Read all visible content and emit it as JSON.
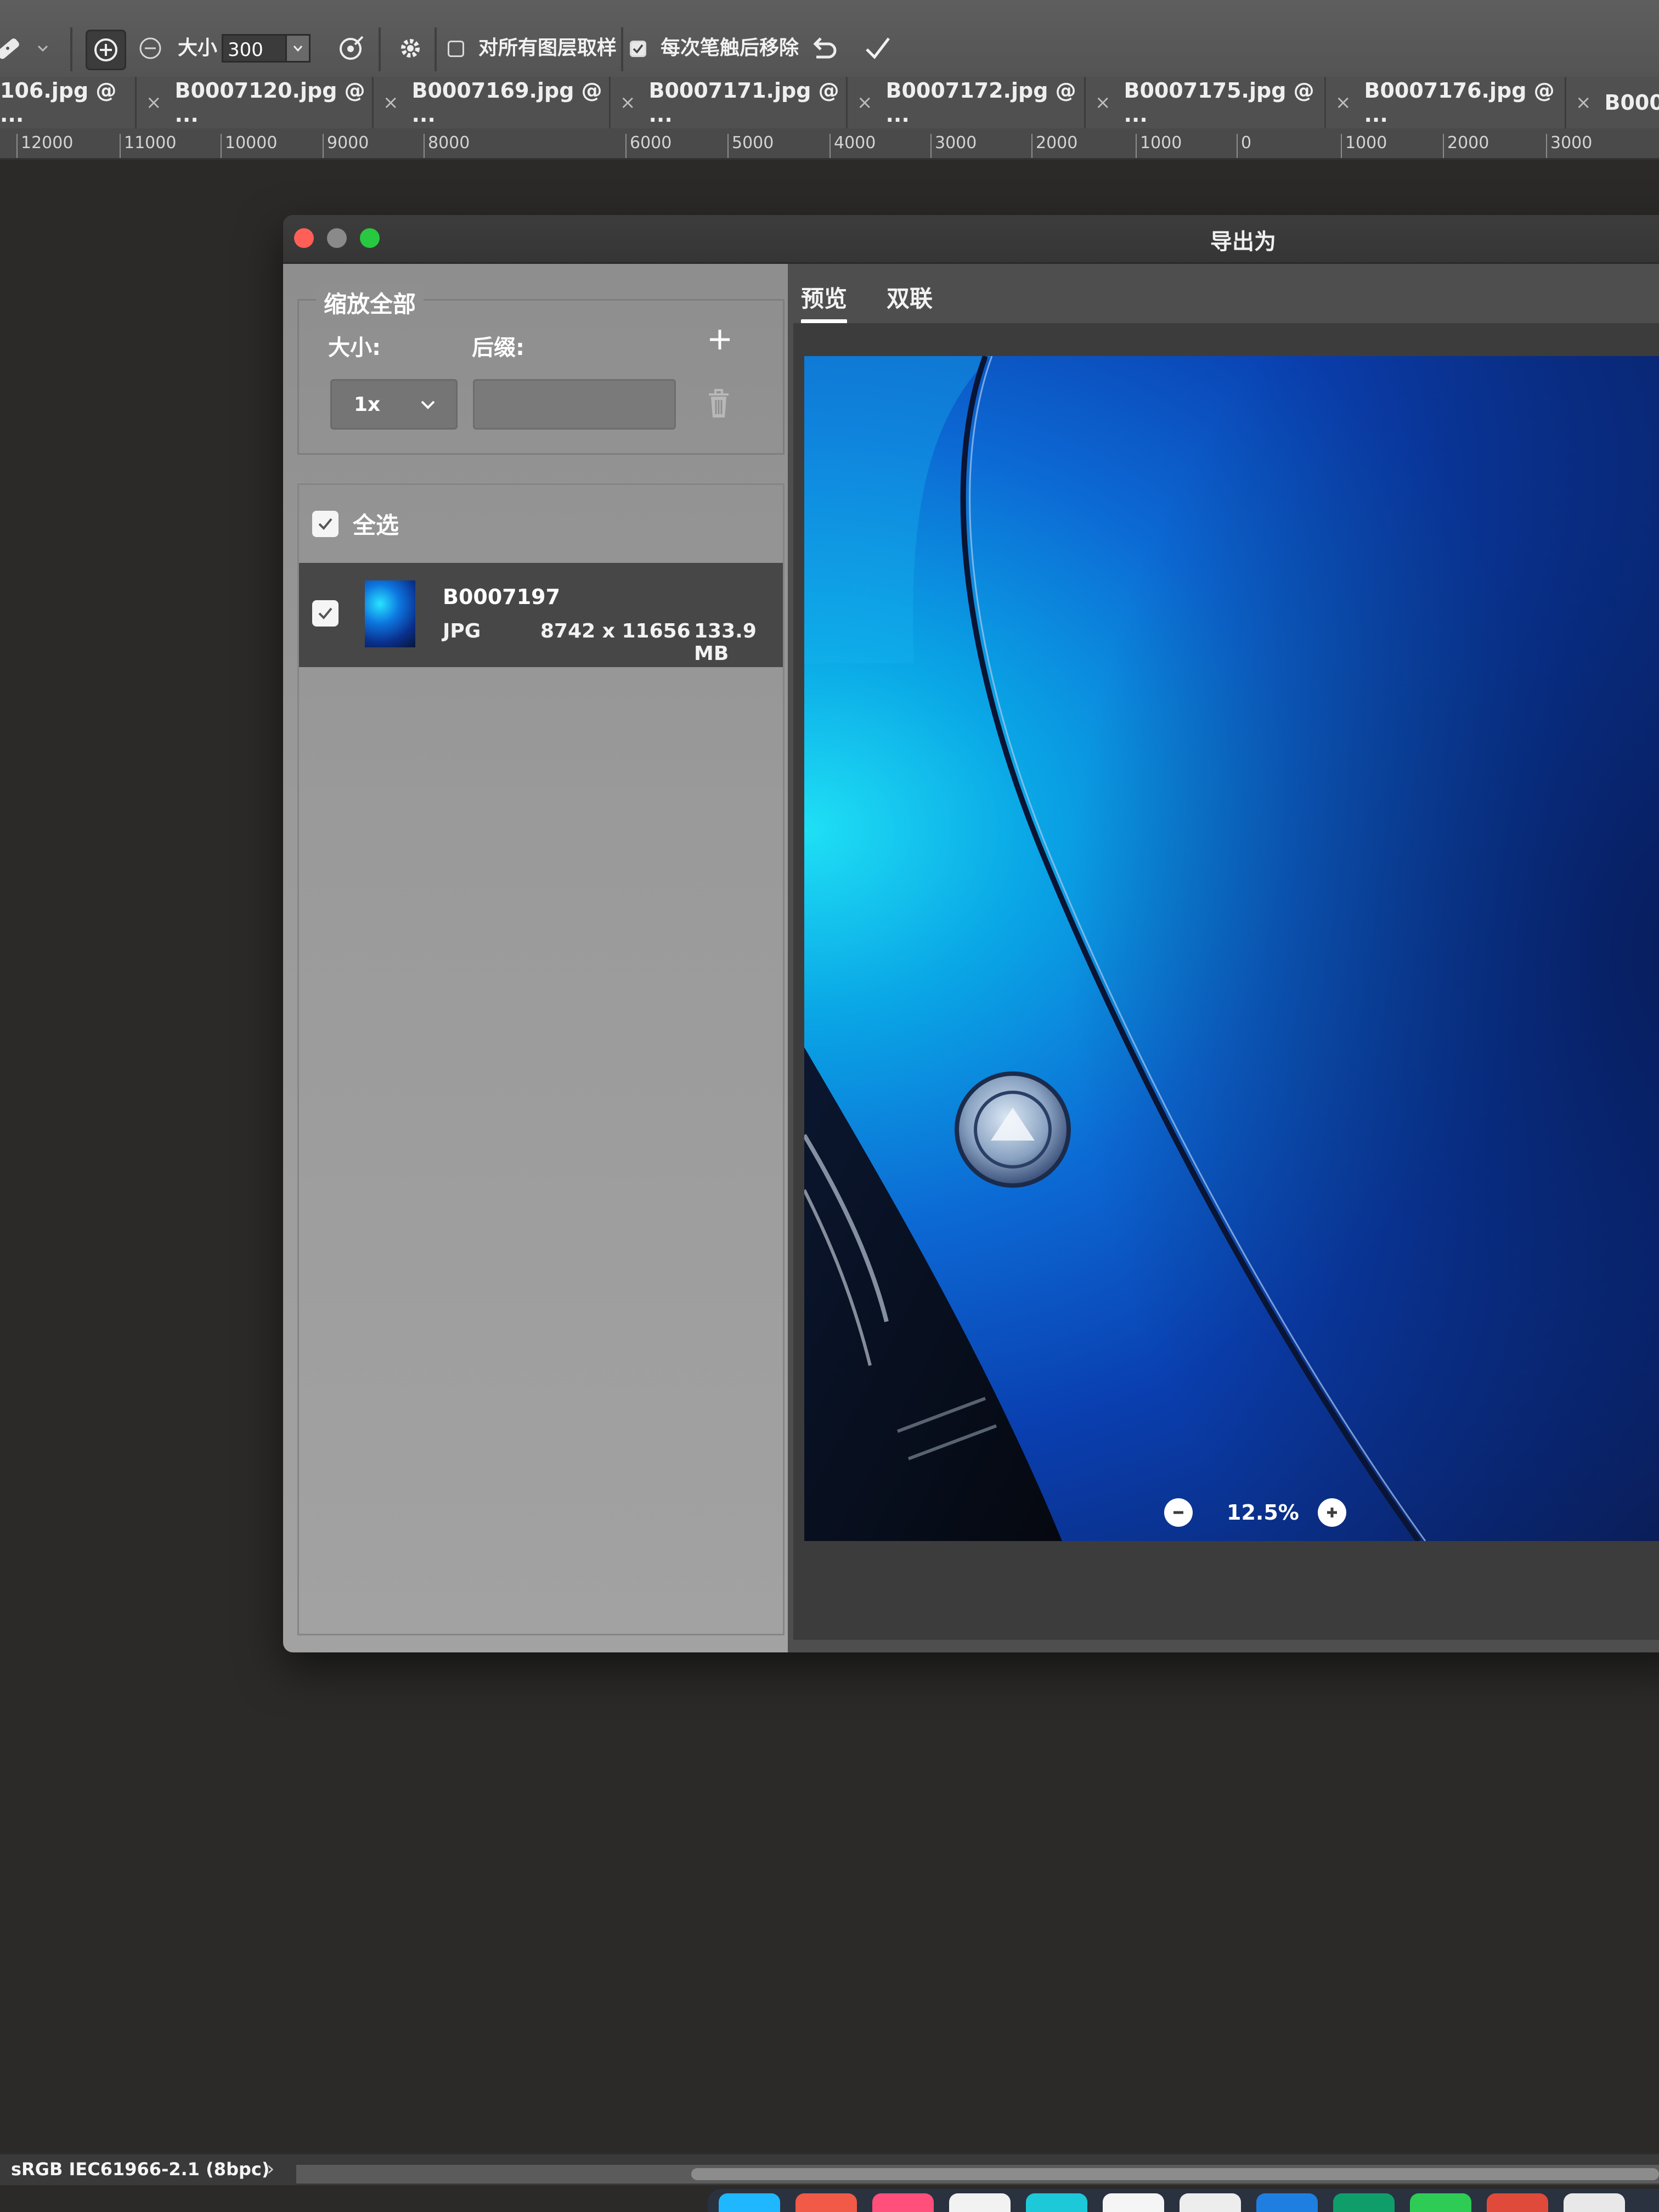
{
  "toolbar": {
    "size_label": "大小",
    "size_value": "300",
    "sample_all_layers_label": "对所有图层取样",
    "remove_after_stroke_label": "每次笔触后移除"
  },
  "tabs": [
    {
      "label": "106.jpg @ ..."
    },
    {
      "label": "B0007120.jpg @ ..."
    },
    {
      "label": "B0007169.jpg @ ..."
    },
    {
      "label": "B0007171.jpg @ ..."
    },
    {
      "label": "B0007172.jpg @ ..."
    },
    {
      "label": "B0007175.jpg @ ..."
    },
    {
      "label": "B0007176.jpg @ ..."
    },
    {
      "label": "B000"
    }
  ],
  "ruler": {
    "ticks": [
      "12000",
      "11000",
      "10000",
      "9000",
      "8000",
      "6000",
      "5000",
      "4000",
      "3000",
      "2000",
      "1000",
      "0",
      "1000",
      "2000",
      "3000"
    ]
  },
  "dialog": {
    "title": "导出为",
    "scale_all_legend": "缩放全部",
    "size_label": "大小:",
    "suffix_label": "后缀:",
    "scale_value": "1x",
    "suffix_value": "",
    "select_all_label": "全选",
    "file": {
      "name": "B0007197",
      "format": "JPG",
      "dimensions": "8742 x 11656",
      "size": "133.9 MB"
    },
    "tabs": {
      "preview": "预览",
      "diptych": "双联"
    },
    "zoom": "12.5%"
  },
  "status": {
    "color_profile": "sRGB IEC61966-2.1 (8bpc)",
    "arrow": "›"
  },
  "colors": {
    "accent_close": "#ff5f57",
    "accent_min": "#8a8a8a",
    "accent_max": "#28c840"
  }
}
